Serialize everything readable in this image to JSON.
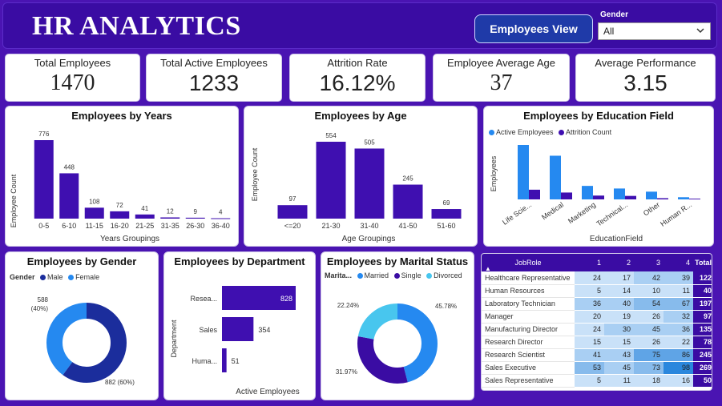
{
  "header": {
    "title": "HR ANALYTICS",
    "view_button": "Employees View",
    "slicer_label": "Gender",
    "slicer_value": "All"
  },
  "kpis": [
    {
      "label": "Total Employees",
      "value": "1470"
    },
    {
      "label": "Total Active Employees",
      "value": "1233"
    },
    {
      "label": "Attrition Rate",
      "value": "16.12%"
    },
    {
      "label": "Employee Average Age",
      "value": "37"
    },
    {
      "label": "Average Performance",
      "value": "3.15"
    }
  ],
  "colors": {
    "primary": "#3a0ca3",
    "bar": "#3f0fb0",
    "active": "#2589f0",
    "dark_blue": "#1b2d9c",
    "light_blue": "#48c6ee",
    "bg": "#4a14b2"
  },
  "chart_data": [
    {
      "type": "bar",
      "title": "Employees by Years",
      "xlabel": "Years Groupings",
      "ylabel": "Employee Count",
      "categories": [
        "0-5",
        "6-10",
        "11-15",
        "16-20",
        "21-25",
        "31-35",
        "26-30",
        "36-40"
      ],
      "values": [
        776,
        448,
        108,
        72,
        41,
        12,
        9,
        4
      ],
      "ylim": [
        0,
        776
      ]
    },
    {
      "type": "bar",
      "title": "Employees by Age",
      "xlabel": "Age Groupings",
      "ylabel": "Employee Count",
      "categories": [
        "<=20",
        "21-30",
        "31-40",
        "41-50",
        "51-60"
      ],
      "values": [
        97,
        554,
        505,
        245,
        69
      ],
      "ylim": [
        0,
        554
      ]
    },
    {
      "type": "bar",
      "title": "Employees by Education Field",
      "xlabel": "EducationField",
      "ylabel": "Employees",
      "categories": [
        "Life Scie...",
        "Medical",
        "Marketing",
        "Technical...",
        "Other",
        "Human R..."
      ],
      "series": [
        {
          "name": "Active Employees",
          "values": [
            500,
            401,
            124,
            100,
            71,
            20
          ]
        },
        {
          "name": "Attrition Count",
          "values": [
            89,
            63,
            35,
            32,
            11,
            7
          ]
        }
      ],
      "legend": "top-left"
    },
    {
      "type": "pie",
      "title": "Employees by Gender",
      "legend_title": "Gender",
      "categories": [
        "Male",
        "Female"
      ],
      "values": [
        882,
        588
      ],
      "labels": [
        "882 (60%)",
        "588 (40%)"
      ]
    },
    {
      "type": "bar",
      "title": "Employees by Department",
      "xlabel": "Active Employees",
      "ylabel": "Department",
      "categories": [
        "Resea...",
        "Sales",
        "Huma..."
      ],
      "values": [
        828,
        354,
        51
      ]
    },
    {
      "type": "pie",
      "title": "Employees by Marital Status",
      "legend_title": "Marita...",
      "categories": [
        "Married",
        "Single",
        "Divorced"
      ],
      "values": [
        45.78,
        31.97,
        22.24
      ],
      "labels": [
        "45.78%",
        "31.97%",
        "22.24%"
      ]
    },
    {
      "type": "table",
      "title": "JobRole",
      "columns": [
        "JobRole",
        "1",
        "2",
        "3",
        "4",
        "Total"
      ],
      "rows": [
        [
          "Healthcare Representative",
          24,
          17,
          42,
          39,
          122
        ],
        [
          "Human Resources",
          5,
          14,
          10,
          11,
          40
        ],
        [
          "Laboratory Technician",
          36,
          40,
          54,
          67,
          197
        ],
        [
          "Manager",
          20,
          19,
          26,
          32,
          97
        ],
        [
          "Manufacturing Director",
          24,
          30,
          45,
          36,
          135
        ],
        [
          "Research Director",
          15,
          15,
          26,
          22,
          78
        ],
        [
          "Research Scientist",
          41,
          43,
          75,
          86,
          245
        ],
        [
          "Sales Executive",
          53,
          45,
          73,
          98,
          269
        ],
        [
          "Sales Representative",
          5,
          11,
          18,
          16,
          50
        ]
      ]
    }
  ]
}
